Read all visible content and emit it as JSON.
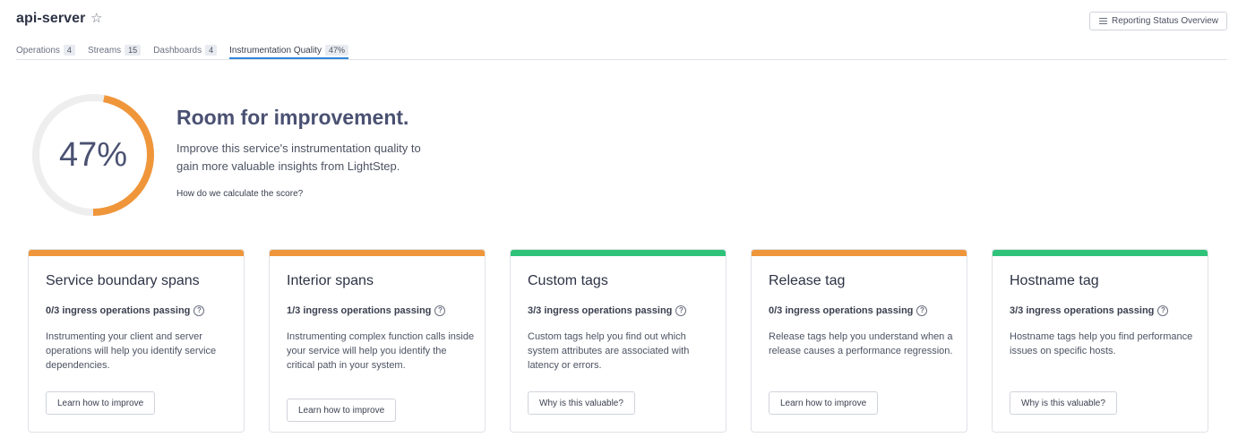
{
  "header": {
    "title": "api-server",
    "report_button": "Reporting Status Overview"
  },
  "tabs": [
    {
      "label": "Operations",
      "count": "4"
    },
    {
      "label": "Streams",
      "count": "15"
    },
    {
      "label": "Dashboards",
      "count": "4"
    },
    {
      "label": "Instrumentation Quality",
      "count": "47%"
    }
  ],
  "score": {
    "value": "47%",
    "fraction": 0.47,
    "heading": "Room for improvement.",
    "description": "Improve this service's instrumentation quality to gain more valuable insights from LightStep.",
    "link": "How do we calculate the score?"
  },
  "colors": {
    "warning": "#f0963a",
    "passing": "#2fc37a",
    "track": "#eeeeee",
    "active_tab": "#2f87d8"
  },
  "cards": [
    {
      "title": "Service boundary spans",
      "passing": "0/3 ingress operations passing",
      "description": "Instrumenting your client and server operations will help you identify service dependencies.",
      "button": "Learn how to improve",
      "status": "warning"
    },
    {
      "title": "Interior spans",
      "passing": "1/3 ingress operations passing",
      "description": "Instrumenting complex function calls inside your service will help you identify the critical path in your system.",
      "button": "Learn how to improve",
      "status": "warning"
    },
    {
      "title": "Custom tags",
      "passing": "3/3 ingress operations passing",
      "description": "Custom tags help you find out which system attributes are associated with latency or errors.",
      "button": "Why is this valuable?",
      "status": "passing"
    },
    {
      "title": "Release tag",
      "passing": "0/3 ingress operations passing",
      "description": "Release tags help you understand when a release causes a performance regression.",
      "button": "Learn how to improve",
      "status": "warning"
    },
    {
      "title": "Hostname tag",
      "passing": "3/3 ingress operations passing",
      "description": "Hostname tags help you find performance issues on specific hosts.",
      "button": "Why is this valuable?",
      "status": "passing"
    }
  ]
}
